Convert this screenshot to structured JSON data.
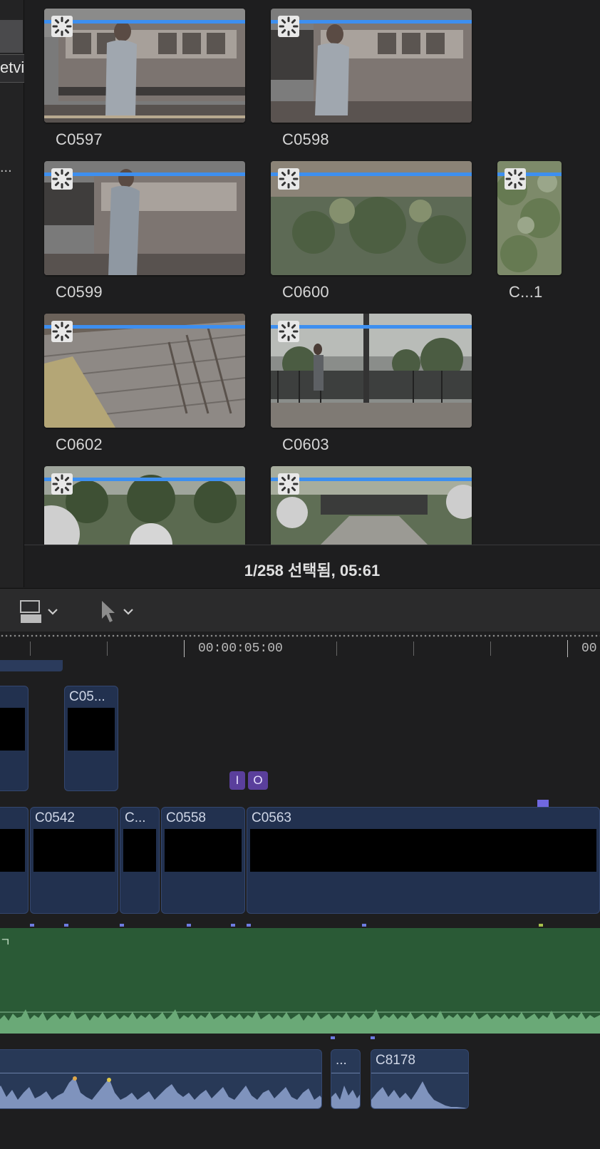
{
  "browser": {
    "tooltip": "etview)",
    "ellipsis": "...",
    "clips": [
      {
        "label": "C0597"
      },
      {
        "label": "C0598"
      },
      {
        "label": "C0599"
      },
      {
        "label": "C0600"
      },
      {
        "label": "C...1"
      },
      {
        "label": "C0602"
      },
      {
        "label": "C0603"
      },
      {
        "label": ""
      },
      {
        "label": ""
      }
    ],
    "status": "1/258 선택됨, 05:61"
  },
  "toolbar": {
    "layout_icon": "clip-appearance-icon",
    "select_tool_icon": "arrow-pointer-icon"
  },
  "ruler": {
    "timecode_1": "00:00:05:00",
    "timecode_2": "00"
  },
  "timeline": {
    "connected_clips": [
      {
        "name": ""
      },
      {
        "name": "C05..."
      }
    ],
    "markers": {
      "in": "I",
      "out": "O"
    },
    "primary_clips": [
      {
        "name": ""
      },
      {
        "name": "C0542"
      },
      {
        "name": "C..."
      },
      {
        "name": "C0558"
      },
      {
        "name": "C0563"
      }
    ],
    "music_label": "ㄱ",
    "audio_clips": [
      {
        "name": ""
      },
      {
        "name": "..."
      },
      {
        "name": "C8178"
      }
    ]
  },
  "colors": {
    "accent_blue": "#3d8ff0",
    "clip_blue": "#22314f",
    "audio_green": "#2a5a36",
    "marker_purple": "#5a3f9c",
    "playhead_marker": "#7068e0"
  }
}
